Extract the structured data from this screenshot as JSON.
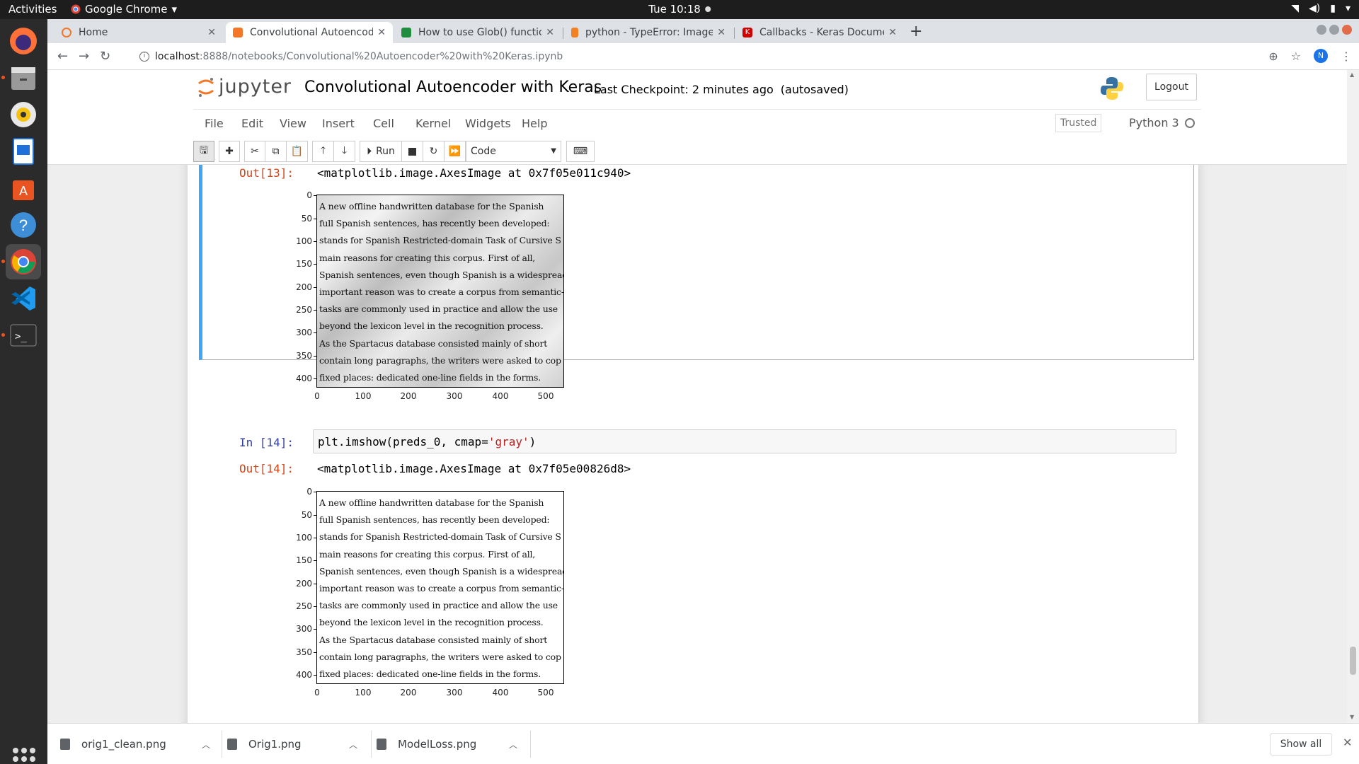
{
  "system": {
    "activities": "Activities",
    "app_name": "Google Chrome",
    "clock": "Tue 10:18"
  },
  "tabs": [
    {
      "title": "Home",
      "color": "#f37726"
    },
    {
      "title": "Convolutional Autoencod",
      "color": "#f37726"
    },
    {
      "title": "How to use Glob() functio",
      "color": "#1e8e3e"
    },
    {
      "title": "python - TypeError: Image",
      "color": "#f48024"
    },
    {
      "title": "Callbacks - Keras Docume",
      "color": "#d00000"
    }
  ],
  "url": {
    "host": "localhost",
    "path": ":8888/notebooks/Convolutional%20Autoencoder%20with%20Keras.ipynb"
  },
  "profile_initial": "N",
  "jupyter": {
    "logo_text": "jupyter",
    "notebook_title": "Convolutional Autoencoder with Keras",
    "checkpoint": "Last Checkpoint: 2 minutes ago",
    "autosave": "(autosaved)",
    "logout": "Logout",
    "menu": [
      "File",
      "Edit",
      "View",
      "Insert",
      "Cell",
      "Kernel",
      "Widgets",
      "Help"
    ],
    "trusted": "Trusted",
    "kernel_name": "Python 3",
    "run_label": "Run",
    "cell_type": "Code"
  },
  "cells": {
    "out13_prompt": "Out[13]:",
    "out13_text": "<matplotlib.image.AxesImage at 0x7f05e011c940>",
    "in14_prompt": "In [14]:",
    "in14_code_prefix": "plt.imshow(preds_0, cmap=",
    "in14_code_string": "'gray'",
    "in14_code_suffix": ")",
    "out14_prompt": "Out[14]:",
    "out14_text": "<matplotlib.image.AxesImage at 0x7f05e00826d8>"
  },
  "plot_text_lines": [
    "    A new offline handwritten database for the Spanish",
    "full Spanish sentences, has recently been developed:",
    "stands for Spanish Restricted-domain Task of Cursive S",
    "main reasons for creating this corpus.  First of all,",
    "Spanish sentences, even though Spanish is a widespread",
    "important reason was to create a corpus from semantic-",
    "tasks are commonly used in practice and allow the use",
    "beyond the lexicon level in the recognition process.",
    "    As the Spartacus database consisted mainly of short",
    "contain long paragraphs, the writers were asked to cop",
    "fixed places:  dedicated one-line fields in the forms."
  ],
  "plot_axes": {
    "y_ticks": [
      "0",
      "50",
      "100",
      "150",
      "200",
      "250",
      "300",
      "350",
      "400"
    ],
    "x_ticks": [
      "0",
      "100",
      "200",
      "300",
      "400",
      "500"
    ]
  },
  "downloads": [
    {
      "name": "orig1_clean.png"
    },
    {
      "name": "Orig1.png"
    },
    {
      "name": "ModelLoss.png"
    }
  ],
  "show_all": "Show all"
}
